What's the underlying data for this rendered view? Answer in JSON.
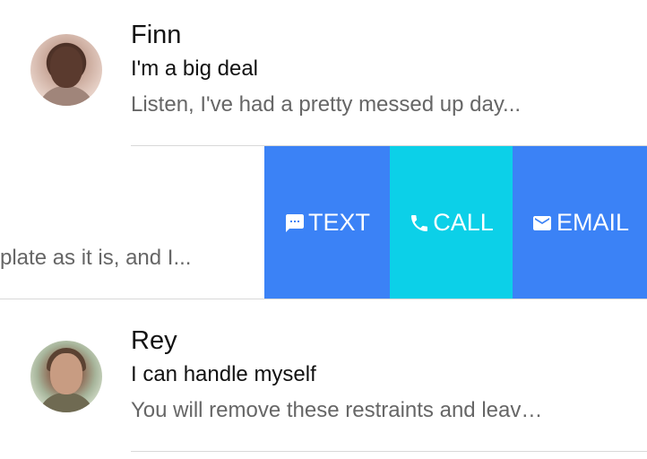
{
  "contacts": [
    {
      "name": "Finn",
      "subject": "I'm a big deal",
      "preview": "Listen, I've had a pretty messed up day..."
    },
    {
      "preview_partial": "plate as it is, and I...",
      "actions": {
        "text_label": "TEXT",
        "call_label": "CALL",
        "email_label": "EMAIL"
      }
    },
    {
      "name": "Rey",
      "subject": "I can handle myself",
      "preview": "You will remove these restraints and leav…"
    }
  ],
  "colors": {
    "text_action": "#3b82f6",
    "call_action": "#0cd0e8",
    "email_action": "#3b82f6"
  },
  "icons": {
    "text": "chat-bubble-icon",
    "call": "phone-icon",
    "email": "envelope-icon"
  }
}
